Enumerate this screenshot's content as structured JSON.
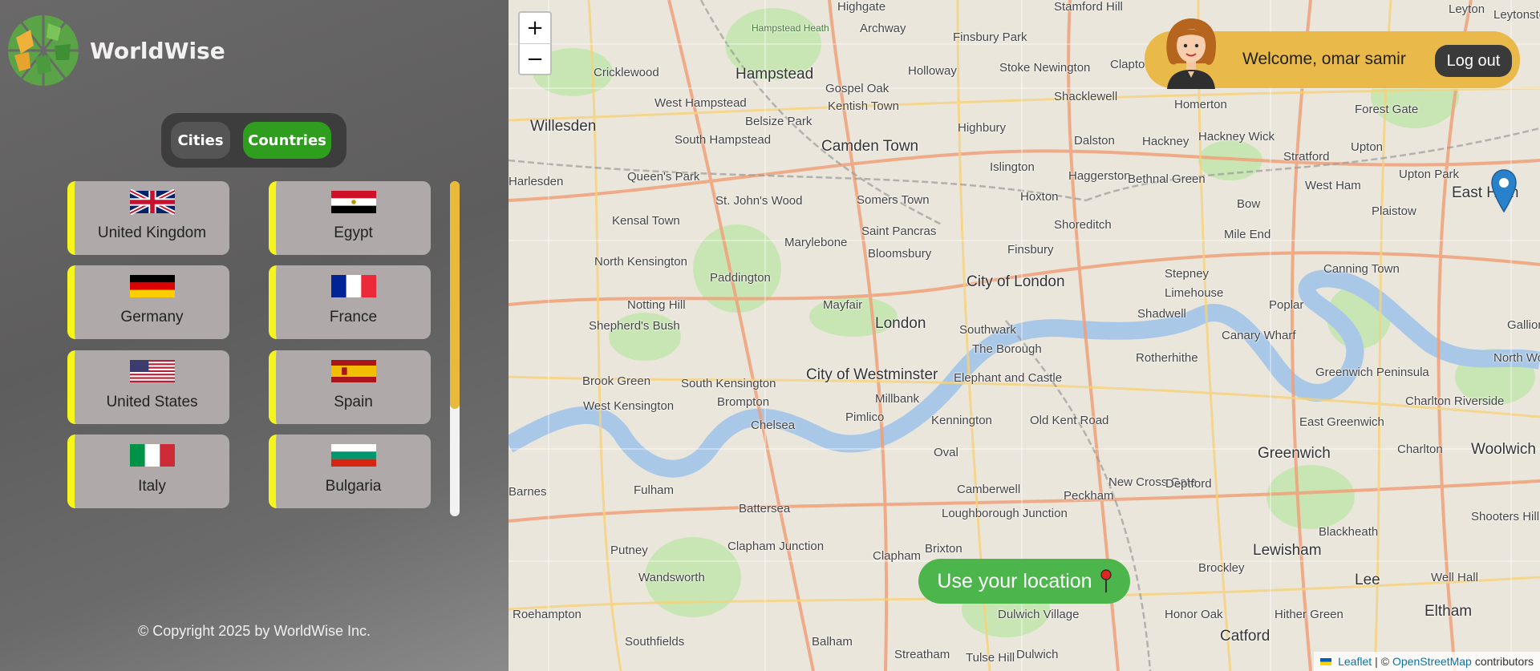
{
  "app": {
    "name": "WorldWise"
  },
  "toggle": {
    "cities_label": "Cities",
    "countries_label": "Countries",
    "active": "Countries"
  },
  "countries": [
    {
      "name": "United Kingdom",
      "flag": "gb-flag-icon"
    },
    {
      "name": "Egypt",
      "flag": "eg-flag-icon"
    },
    {
      "name": "Germany",
      "flag": "de-flag-icon"
    },
    {
      "name": "France",
      "flag": "fr-flag-icon"
    },
    {
      "name": "United States",
      "flag": "us-flag-icon"
    },
    {
      "name": "Spain",
      "flag": "es-flag-icon"
    },
    {
      "name": "Italy",
      "flag": "it-flag-icon"
    },
    {
      "name": "Bulgaria",
      "flag": "bg-flag-icon"
    }
  ],
  "footer": {
    "text": "© Copyright 2025 by WorldWise Inc."
  },
  "map": {
    "zoom_in": "+",
    "zoom_out": "−",
    "places": [
      "Highgate",
      "Archway",
      "Stamford Hill",
      "Leyton",
      "Leytonstone",
      "Hampstead Heath",
      "Finsbury Park",
      "Hampstead",
      "Cricklewood",
      "Gospel Oak",
      "Kentish Town",
      "Holloway",
      "Stoke Newington",
      "Clapton",
      "Homerton",
      "West Hampstead",
      "Belsize Park",
      "Shacklewell",
      "Hackney",
      "Hackney Wick",
      "Forest Gate",
      "Willesden",
      "South Hampstead",
      "Camden Town",
      "Highbury",
      "Dalston",
      "Stratford",
      "Upton",
      "Harlesden",
      "Queen's Park",
      "Islington",
      "Haggerston",
      "West Ham",
      "Upton Park",
      "East Ham",
      "St. John's Wood",
      "Somers Town",
      "Hoxton",
      "Bethnal Green",
      "Bow",
      "Kensal Town",
      "Plaistow",
      "Saint Pancras",
      "Shoreditch",
      "Mile End",
      "Marylebone",
      "North Kensington",
      "Bloomsbury",
      "Finsbury",
      "Paddington",
      "Stepney",
      "Canning Town",
      "City of London",
      "Limehouse",
      "Notting Hill",
      "Mayfair",
      "Shadwell",
      "Poplar",
      "Shepherd's Bush",
      "London",
      "Southwark",
      "Canary Wharf",
      "The Borough",
      "Rotherhithe",
      "North Woolwich",
      "Brook Green",
      "South Kensington",
      "City of Westminster",
      "Elephant and Castle",
      "Greenwich Peninsula",
      "West Kensington",
      "Brompton",
      "Millbank",
      "Charlton Riverside",
      "Chelsea",
      "Pimlico",
      "Kennington",
      "Old Kent Road",
      "East Greenwich",
      "Oval",
      "Greenwich",
      "Charlton",
      "Woolwich",
      "Fulham",
      "Battersea",
      "Camberwell",
      "New Cross Gate",
      "Deptford",
      "Peckham",
      "Loughborough Junction",
      "Blackheath",
      "Shooters Hill",
      "Clapham Junction",
      "Brixton",
      "Clapham",
      "Putney",
      "Lewisham",
      "Brockley",
      "Wandsworth",
      "Well Hall",
      "Lee",
      "Dulwich Village",
      "Roehampton",
      "Honor Oak",
      "Hither Green",
      "Eltham",
      "Southfields",
      "Balham",
      "Streatham",
      "Tulse Hill",
      "Dulwich",
      "Catford",
      "Barnes",
      "Gallions Reach"
    ]
  },
  "user": {
    "welcome": "Welcome, omar samir",
    "logout_label": "Log out",
    "avatar": "user-avatar-icon"
  },
  "location": {
    "label": "Use your location",
    "icon": "pushpin-icon"
  },
  "attribution": {
    "leaflet": "Leaflet",
    "sep": "| ©",
    "osm": "OpenStreetMap",
    "contributors": "contributors"
  },
  "colors": {
    "accent_green": "#2f9e1f",
    "card_border": "#f5f51d",
    "user_pill": "#e9b949",
    "location_button": "#4cb54c",
    "marker_blue": "#2a81cb"
  }
}
